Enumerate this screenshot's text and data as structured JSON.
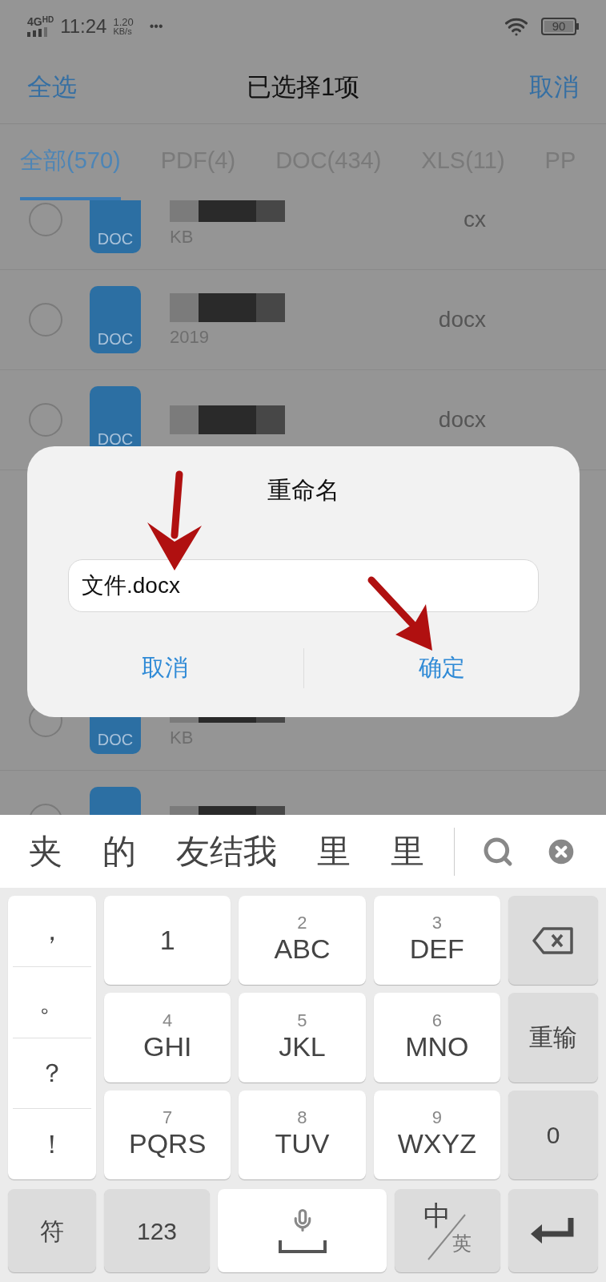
{
  "status_bar": {
    "network": "4G",
    "network_badge": "HD",
    "time": "11:24",
    "speed_value": "1.20",
    "speed_unit": "KB/s",
    "more": "•••",
    "battery": "90"
  },
  "header": {
    "left": "全选",
    "title": "已选择1项",
    "right": "取消"
  },
  "tabs": [
    {
      "label": "全部(570)",
      "selected": true
    },
    {
      "label": "PDF(4)",
      "selected": false
    },
    {
      "label": "DOC(434)",
      "selected": false
    },
    {
      "label": "XLS(11)",
      "selected": false
    },
    {
      "label": "PP",
      "selected": false
    }
  ],
  "rows": [
    {
      "icon_label": "DOC",
      "checked": false,
      "name_fragment": "cx",
      "meta_fragment": "KB"
    },
    {
      "icon_label": "DOC",
      "checked": false,
      "name_fragment": "docx",
      "meta_fragment": "2019"
    },
    {
      "icon_label": "DOC",
      "checked": false,
      "name_fragment": "docx"
    },
    {
      "icon_label": "DOC",
      "checked": false,
      "meta_fragment": "KB"
    },
    {
      "checked": false
    }
  ],
  "dialog": {
    "title": "重命名",
    "value": "文件.docx",
    "buttons": [
      "取消",
      "确定"
    ]
  },
  "keyboard": {
    "candidates": [
      "夹",
      "的",
      "友结我",
      "里",
      "里"
    ],
    "punctuation": [
      "，",
      "。",
      "？",
      "！"
    ],
    "rows": [
      [
        {
          "kind": "char",
          "main": "1"
        },
        {
          "kind": "char",
          "sub": "2",
          "main": "ABC"
        },
        {
          "kind": "char",
          "sub": "3",
          "main": "DEF"
        },
        {
          "kind": "backspace"
        }
      ],
      [
        {
          "kind": "char",
          "sub": "4",
          "main": "GHI"
        },
        {
          "kind": "char",
          "sub": "5",
          "main": "JKL"
        },
        {
          "kind": "char",
          "sub": "6",
          "main": "MNO"
        },
        {
          "kind": "function",
          "main": "重输"
        }
      ],
      [
        {
          "kind": "char",
          "sub": "7",
          "main": "PQRS"
        },
        {
          "kind": "char",
          "sub": "8",
          "main": "TUV"
        },
        {
          "kind": "char",
          "sub": "9",
          "main": "WXYZ"
        },
        {
          "kind": "function",
          "main": "0"
        }
      ]
    ],
    "bottom": [
      {
        "kind": "function",
        "main": "符"
      },
      {
        "kind": "function",
        "main": "123"
      },
      {
        "kind": "space"
      },
      {
        "kind": "lang",
        "main": "中",
        "sub": "英"
      },
      {
        "kind": "enter"
      }
    ]
  }
}
